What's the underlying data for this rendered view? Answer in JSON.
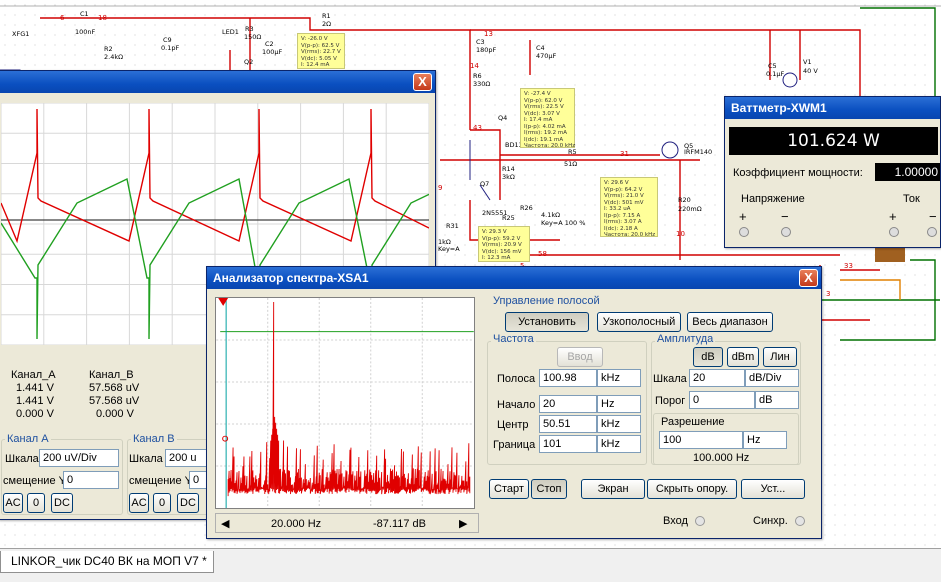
{
  "schematic": {
    "component_labels": [
      {
        "id": "c1",
        "text": "C1"
      },
      {
        "id": "c1v",
        "text": "100nF"
      },
      {
        "id": "r2",
        "text": "R2"
      },
      {
        "id": "r2v",
        "text": "2.4kΩ"
      },
      {
        "id": "c9",
        "text": "C9"
      },
      {
        "id": "c9v",
        "text": "0.1pF"
      },
      {
        "id": "led",
        "text": "LED1"
      },
      {
        "id": "r3",
        "text": "R3"
      },
      {
        "id": "r3v",
        "text": "150Ω"
      },
      {
        "id": "c2",
        "text": "C2"
      },
      {
        "id": "c2v",
        "text": "100µF"
      },
      {
        "id": "q2",
        "text": "Q2"
      },
      {
        "id": "r1",
        "text": "R1"
      },
      {
        "id": "r1v",
        "text": "2Ω"
      },
      {
        "id": "c3",
        "text": "C3"
      },
      {
        "id": "c3v",
        "text": "180pF"
      },
      {
        "id": "c4",
        "text": "C4"
      },
      {
        "id": "c4v",
        "text": "470µF"
      },
      {
        "id": "r6",
        "text": "R6"
      },
      {
        "id": "r6v",
        "text": "330Ω"
      },
      {
        "id": "q4",
        "text": "Q4"
      },
      {
        "id": "bd",
        "text": "BD139"
      },
      {
        "id": "r14",
        "text": "R14"
      },
      {
        "id": "r14v",
        "text": "3kΩ"
      },
      {
        "id": "q7",
        "text": "Q7"
      },
      {
        "id": "n2",
        "text": "2N5551"
      },
      {
        "id": "r5",
        "text": "R5"
      },
      {
        "id": "r5v",
        "text": "51Ω"
      },
      {
        "id": "q5",
        "text": "Q5"
      },
      {
        "id": "irf",
        "text": "IRFM140"
      },
      {
        "id": "r26",
        "text": "R26"
      },
      {
        "id": "r26v",
        "text": "4.1kΩ"
      },
      {
        "id": "r26k",
        "text": "Key=A 100 %"
      },
      {
        "id": "r25",
        "text": "R25"
      },
      {
        "id": "r31",
        "text": "R31"
      },
      {
        "id": "r31v",
        "text": "1kΩ"
      },
      {
        "id": "r31k",
        "text": "Key=A"
      },
      {
        "id": "r20",
        "text": "R20"
      },
      {
        "id": "r20v",
        "text": "220mΩ"
      },
      {
        "id": "c5",
        "text": "C5"
      },
      {
        "id": "c5v",
        "text": "0.1µF"
      },
      {
        "id": "v1",
        "text": "V1"
      },
      {
        "id": "v1v",
        "text": "40 V"
      },
      {
        "id": "xfg",
        "text": "XFG1"
      }
    ],
    "net_numbers": [
      "6",
      "18",
      "13",
      "14",
      "43",
      "31",
      "10",
      "58",
      "33",
      "3",
      "9",
      "5"
    ],
    "probes": [
      "V: -26.0 V\nV(p-p): 62.5 V\nV(rms): 22.7 V\nV(dc): 5.05 V\nI: 12.4 mA",
      "V: -27.4 V\nV(p-p): 62.0 V\nV(rms): 22.5 V\nV(dc): 3.07 V\nI: 17.4 mA\nI(p-p): 4.02 mA\nI(rms): 19.2 mA\nI(dc): 19.1 mA\nЧастота: 20.0 kHz",
      "V: 29.6 V\nV(p-p): 64.2 V\nV(rms): 21.0 V\nV(dc): 501 mV\nI: 33.2 uA\nI(p-p): 7.15 A\nI(rms): 3.07 A\nI(dc): 2.18 A\nЧастота: 20.0 kHz",
      "V: 29.3 V\nV(p-p): 59.2 V\nV(rms): 20.9 V\nV(dc): 156 mV\nI: 12.3 mA"
    ]
  },
  "oscilloscope": {
    "table_headers": [
      "Канал_А",
      "Канал_B"
    ],
    "rows": [
      [
        "1.441 V",
        "57.568 uV"
      ],
      [
        "1.441 V",
        "57.568 uV"
      ],
      [
        "0.000 V",
        "0.000 V"
      ]
    ],
    "channel_a": {
      "title": "Канал A",
      "scale_label": "Шкала",
      "scale": "200 uV/Div",
      "offset_label": "смещение Y",
      "offset": "0"
    },
    "channel_b": {
      "title": "Канал B",
      "scale_label": "Шкала",
      "scale": "200 u",
      "offset_label": "смещение Y",
      "offset": "0"
    },
    "coupling": [
      "AC",
      "0",
      "DC"
    ],
    "close": "X"
  },
  "wattmeter": {
    "title": "Ваттметр-XWM1",
    "reading": "101.624 W",
    "pf_label": "Коэффициент мощности:",
    "pf_value": "1.00000",
    "voltage_label": "Напряжение",
    "current_label": "Ток",
    "plus": "+",
    "minus": "−"
  },
  "analyzer": {
    "title": "Анализатор спектра-XSA1",
    "close": "X",
    "span_group": "Управление полосой",
    "btn_set": "Установить",
    "btn_narrow": "Узкополосный",
    "btn_full": "Весь диапазон",
    "freq_group": "Частота",
    "btn_enter": "Ввод",
    "span_label": "Полоса",
    "span_value": "100.98",
    "span_unit": "kHz",
    "start_label": "Начало",
    "start_value": "20",
    "start_unit": "Hz",
    "center_label": "Центр",
    "center_value": "50.51",
    "center_unit": "kHz",
    "end_label": "Граница",
    "end_value": "101",
    "end_unit": "kHz",
    "amp_group": "Амплитуда",
    "amp_db": "dB",
    "amp_dbm": "dBm",
    "amp_lin": "Лин",
    "scale_label": "Шкала",
    "scale_value": "20",
    "scale_unit": "dB/Div",
    "thr_label": "Порог",
    "thr_value": "0",
    "thr_unit": "dB",
    "res_label": "Разрешение",
    "res_value": "100",
    "res_unit": "Hz",
    "res_text": "100.000  Hz",
    "btn_start": "Старт",
    "btn_stop": "Стоп",
    "btn_screen": "Экран",
    "btn_hide": "Скрыть опору.",
    "btn_setup": "Уст...",
    "cursor_freq": "20.000  Hz",
    "cursor_amp": "-87.117  dB",
    "input_label": "Вход",
    "sync_label": "Синхр.",
    "left_arrow": "◀",
    "right_arrow": "▶"
  },
  "statusbar": {
    "tab_label": "LINKOR_чик DC40 ВК на МОП V7 *"
  },
  "colors": {
    "titlebar": "#0a4fc0",
    "wire_red": "#d00000",
    "wire_green": "#007000",
    "probe_bg": "#ffff99",
    "trace_red": "#e00000",
    "trace_green": "#20a020"
  }
}
